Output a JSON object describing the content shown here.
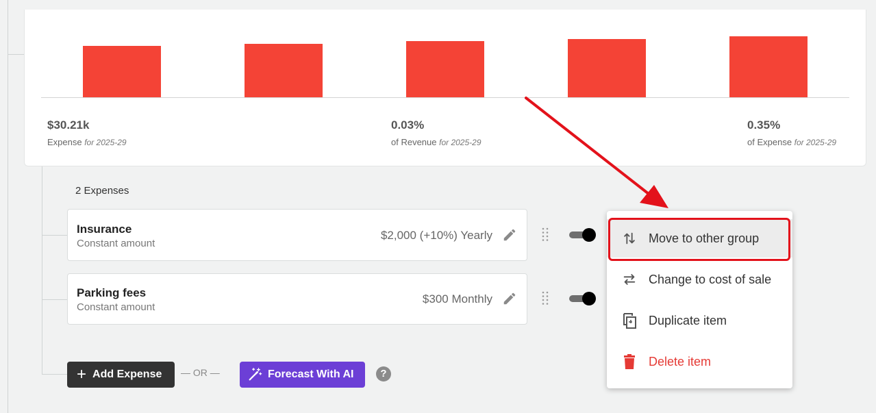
{
  "chart_data": {
    "type": "bar",
    "categories": [
      "",
      "",
      "",
      "",
      ""
    ],
    "values": [
      7.5,
      7.8,
      8.2,
      8.5,
      8.9
    ],
    "ylim": [
      0,
      10
    ],
    "bar_color": "#f44336"
  },
  "summary": {
    "expense": {
      "value": "$30.21k",
      "label": "Expense",
      "period": "for 2025-29"
    },
    "revenue_pct": {
      "value": "0.03%",
      "label": "of Revenue",
      "period": "for 2025-29"
    },
    "expense_pct": {
      "value": "0.35%",
      "label": "of Expense",
      "period": "for 2025-29"
    }
  },
  "expenses": {
    "count_label": "2 Expenses",
    "items": [
      {
        "name": "Insurance",
        "type": "Constant amount",
        "amount": "$2,000 (+10%) Yearly",
        "enabled": true
      },
      {
        "name": "Parking fees",
        "type": "Constant amount",
        "amount": "$300 Monthly",
        "enabled": true
      }
    ]
  },
  "actions": {
    "add_label": "Add Expense",
    "or_label": "— OR —",
    "ai_label": "Forecast With AI",
    "help_label": "?"
  },
  "context_menu": {
    "items": [
      {
        "label": "Move to other group",
        "icon": "swap-vertical-icon",
        "highlighted": true
      },
      {
        "label": "Change to cost of sale",
        "icon": "swap-horizontal-icon"
      },
      {
        "label": "Duplicate item",
        "icon": "duplicate-icon"
      },
      {
        "label": "Delete item",
        "icon": "trash-icon",
        "danger": true
      }
    ]
  },
  "colors": {
    "accent_ai": "#6c3fd6",
    "danger": "#e53a35",
    "annotation": "#e3121b"
  }
}
